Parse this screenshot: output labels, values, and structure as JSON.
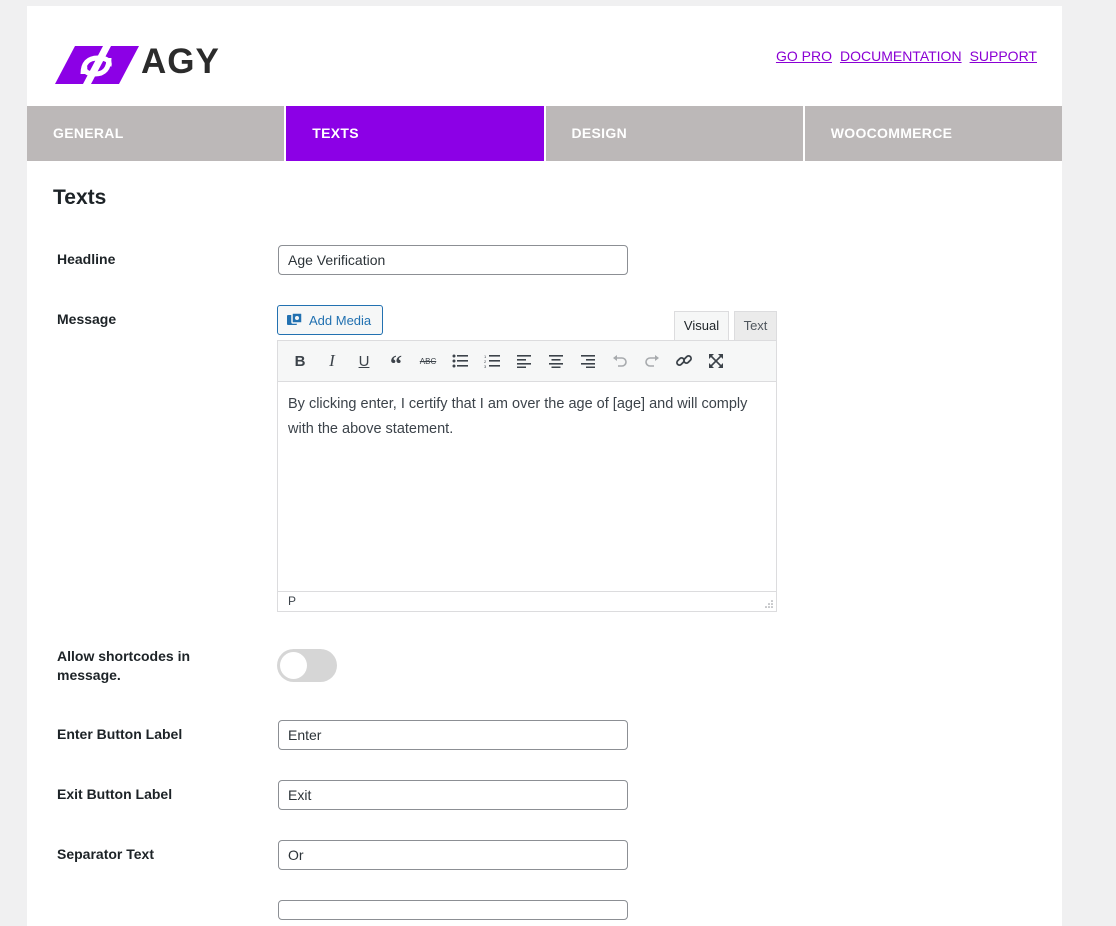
{
  "brand": {
    "name": "AGY",
    "accent": "#8c00e6"
  },
  "header_links": [
    {
      "label": "GO PRO"
    },
    {
      "label": "DOCUMENTATION"
    },
    {
      "label": "SUPPORT"
    }
  ],
  "tabs": [
    {
      "label": "GENERAL",
      "active": false
    },
    {
      "label": "TEXTS",
      "active": true
    },
    {
      "label": "DESIGN",
      "active": false
    },
    {
      "label": "WOOCOMMERCE",
      "active": false
    }
  ],
  "section": {
    "title": "Texts"
  },
  "fields": {
    "headline": {
      "label": "Headline",
      "value": "Age Verification"
    },
    "message": {
      "label": "Message",
      "add_media": "Add Media",
      "mode_visual": "Visual",
      "mode_text": "Text",
      "content": "By clicking enter, I certify that I am over the age of [age] and will comply with the above statement.",
      "status_path": "P"
    },
    "allow_shortcodes": {
      "label": "Allow shortcodes in message.",
      "enabled": false
    },
    "enter_button": {
      "label": "Enter Button Label",
      "value": "Enter"
    },
    "exit_button": {
      "label": "Exit Button Label",
      "value": "Exit"
    },
    "separator": {
      "label": "Separator Text",
      "value": "Or"
    }
  },
  "toolbar_icons": [
    "bold-icon",
    "italic-icon",
    "underline-icon",
    "blockquote-icon",
    "strikethrough-icon",
    "bullet-list-icon",
    "numbered-list-icon",
    "align-left-icon",
    "align-center-icon",
    "align-right-icon",
    "undo-icon",
    "redo-icon",
    "link-icon",
    "fullscreen-icon"
  ]
}
